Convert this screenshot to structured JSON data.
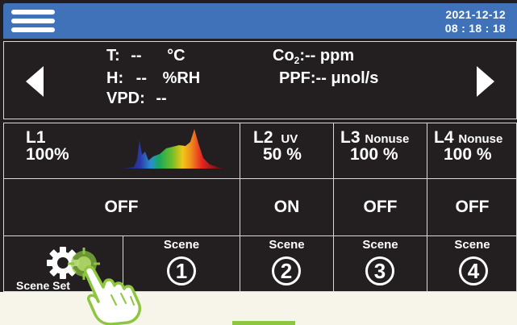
{
  "header": {
    "date": "2021-12-12",
    "time": "08 : 18 : 18",
    "menu_icon": "hamburger-menu-icon",
    "bar_color": "#3f72b8"
  },
  "sensors": {
    "t_label": "T:",
    "t_value": "--",
    "t_unit": "°C",
    "h_label": "H:",
    "h_value": "--",
    "h_unit": "%RH",
    "vpd_label": "VPD:",
    "vpd_value": "--",
    "co2_label_main": "Co",
    "co2_label_sub": "2",
    "co2_rest": ":-- ppm",
    "ppf_text": "PPF:-- μnol/s"
  },
  "lights": [
    {
      "name": "L1",
      "tag": "",
      "percent": "100%",
      "state": "OFF"
    },
    {
      "name": "L2",
      "tag": "UV",
      "percent": "50 %",
      "state": "ON"
    },
    {
      "name": "L3",
      "tag": "Nonuse",
      "percent": "100 %",
      "state": "OFF"
    },
    {
      "name": "L4",
      "tag": "Nonuse",
      "percent": "100 %",
      "state": "OFF"
    }
  ],
  "scenes": {
    "setting_label": "Scene Setting",
    "setting_label_visible": "Scene Set",
    "label": "Scene",
    "numbers": [
      "1",
      "2",
      "3",
      "4"
    ]
  },
  "colors": {
    "panel": "#231f20",
    "accent_green": "#8dc63f"
  }
}
